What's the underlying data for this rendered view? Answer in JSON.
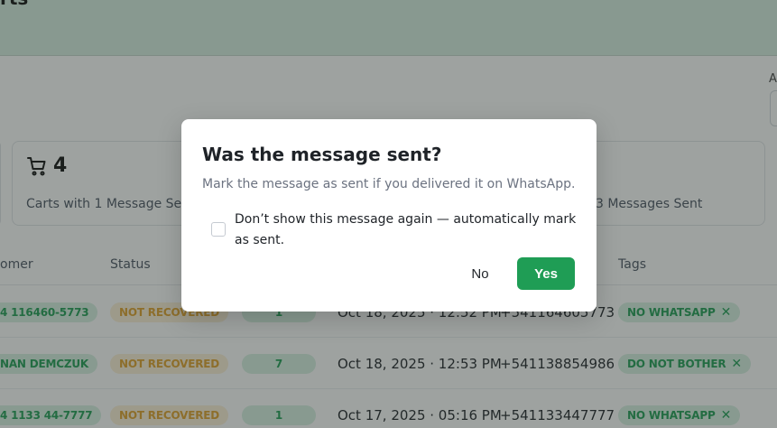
{
  "page": {
    "title_fragment": "rts",
    "right_label_fragment": "A"
  },
  "stats": {
    "card_one": {
      "icon": "shopping-cart-icon",
      "value": "4",
      "label": "Carts with 1 Message Sent"
    },
    "card_three": {
      "label_fragment": "3 Messages Sent"
    }
  },
  "table": {
    "headers": {
      "customer": "omer",
      "status": "Status",
      "tags": "Tags"
    },
    "rows": [
      {
        "customer": "4 116460-5773",
        "status": "NOT RECOVERED",
        "count": "1",
        "date": "Oct 18, 2025 · 12:52 PM",
        "phone": "+541164605773",
        "tag": "NO WHATSAPP"
      },
      {
        "customer": "NAN DEMCZUK",
        "status": "NOT RECOVERED",
        "count": "7",
        "date": "Oct 18, 2025 · 12:53 PM",
        "phone": "+541138854986",
        "tag": "DO NOT BOTHER"
      },
      {
        "customer": "4 1133 44-7777",
        "status": "NOT RECOVERED",
        "count": "1",
        "date": "Oct 17, 2025 · 05:16 PM",
        "phone": "+541133447777",
        "tag": "NO WHATSAPP"
      }
    ],
    "tag_remove_glyph": "✕"
  },
  "modal": {
    "title": "Was the message sent?",
    "description": "Mark the message as sent if you delivered it on WhatsApp.",
    "checkbox_label": "Don’t show this message again — automatically mark as sent.",
    "checkbox_checked": false,
    "no_label": "No",
    "yes_label": "Yes"
  },
  "colors": {
    "accent": "#1f9d55",
    "pill_green_bg": "#d7f1e2",
    "pill_orange_bg": "#fdf0d8",
    "pill_orange_text": "#e0a12a",
    "header_band": "#d8efe2"
  }
}
